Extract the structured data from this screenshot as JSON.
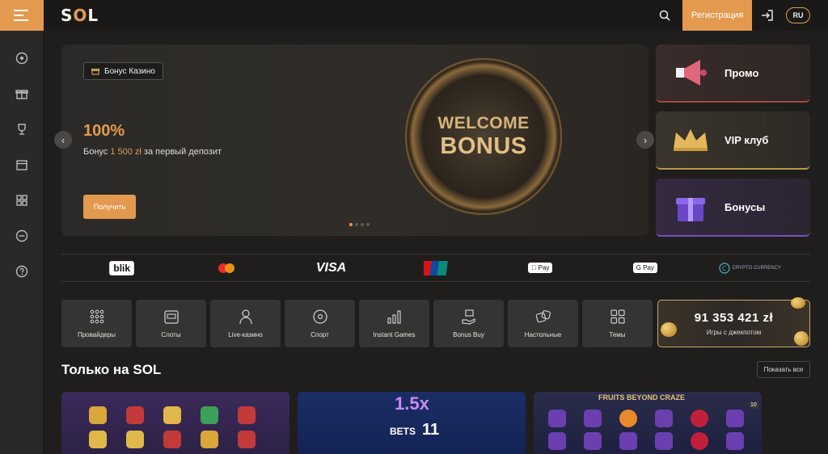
{
  "brand": {
    "logo_pre": "S",
    "logo_o": "O",
    "logo_post": "L"
  },
  "header": {
    "register_label": "Регистрация",
    "lang_label": "RU"
  },
  "colors": {
    "accent": "#e39a4f",
    "background": "#1f1e1d",
    "card": "#363432"
  },
  "sidebar": {
    "items": [
      {
        "icon": "ball-icon"
      },
      {
        "icon": "gift-icon"
      },
      {
        "icon": "trophy-icon"
      },
      {
        "icon": "calendar-icon"
      },
      {
        "icon": "grid-icon"
      },
      {
        "icon": "24-7-support-icon"
      },
      {
        "icon": "help-icon"
      }
    ]
  },
  "hero": {
    "badge": "Бонус Казино",
    "percent": "100%",
    "text_pre": "Бонус ",
    "text_highlight": "1 500 zł",
    "text_post": " за первый депозит",
    "cta": "Получить",
    "coin_line1": "WELCOME",
    "coin_line2": "BONUS",
    "slides_total": 4,
    "slide_active": 1
  },
  "promo_cards": [
    {
      "label": "Промо"
    },
    {
      "label": "VIP клуб"
    },
    {
      "label": "Бонусы"
    }
  ],
  "payments": {
    "blik": "blik",
    "visa": "VISA",
    "unionpay": "UnionPay",
    "apple_pay": "Pay",
    "google_pay": "G Pay",
    "crypto": "CRYPTO CURRENCY"
  },
  "categories": [
    {
      "label": "Провайдеры"
    },
    {
      "label": "Слоты"
    },
    {
      "label": "Live-казино"
    },
    {
      "label": "Спорт"
    },
    {
      "label": "Instant Games"
    },
    {
      "label": "Bonus Buy"
    },
    {
      "label": "Настольные"
    },
    {
      "label": "Темы"
    }
  ],
  "jackpot": {
    "amount": "91 353 421 zł",
    "label": "Игры с джекпотом"
  },
  "section": {
    "title": "Только на SOL",
    "show_all": "Показать все"
  },
  "games": {
    "g2_multiplier": "1.5x",
    "g2_bets_label": "BETS",
    "g2_bets_value": "11",
    "g3_title": "FRUITS BEYOND CRAZE",
    "g3_badge": "10"
  }
}
